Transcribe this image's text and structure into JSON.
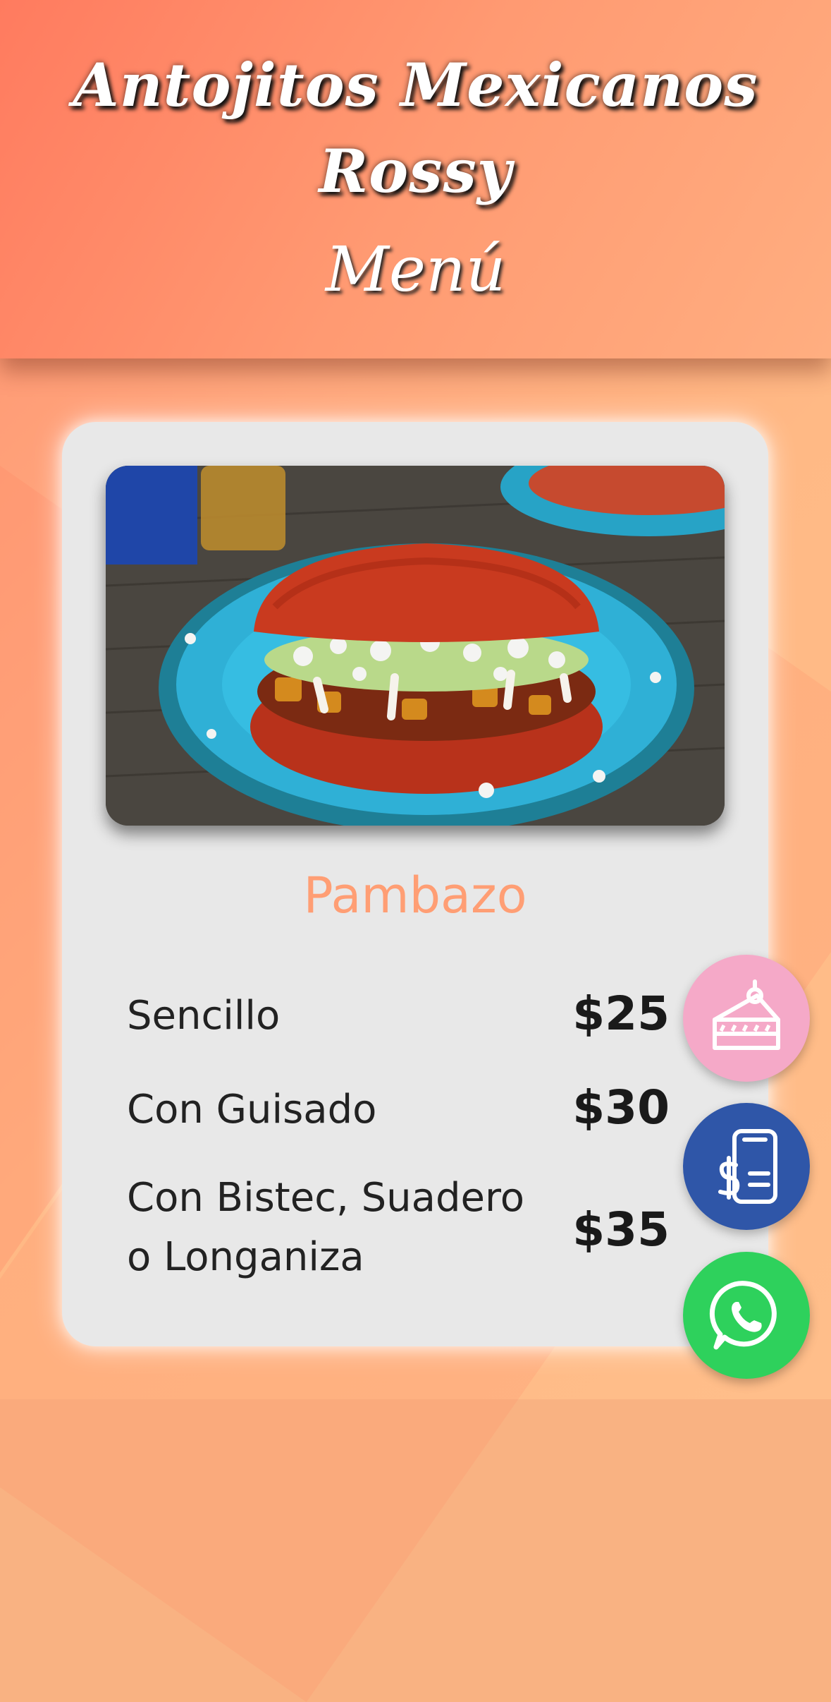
{
  "header": {
    "title_line1": "Antojitos Mexicanos",
    "title_line2": "Rossy",
    "subtitle": "Menú"
  },
  "card": {
    "photo_alt": "Pambazo",
    "item_name": "Pambazo",
    "prices": [
      {
        "label": "Sencillo",
        "price": "$25"
      },
      {
        "label": "Con Guisado",
        "price": "$30"
      },
      {
        "label_line1": "Con Bistec, Suadero",
        "label_line2": "o Longaniza",
        "price": "$35"
      }
    ]
  },
  "fabs": [
    {
      "icon": "cake-icon",
      "color": "#f5a9c8"
    },
    {
      "icon": "mobile-payment-icon",
      "color": "#2f56a8"
    },
    {
      "icon": "whatsapp-icon",
      "color": "#2ed15c"
    }
  ],
  "colors": {
    "header_from": "#ff7b5f",
    "header_to": "#ffae80",
    "card_bg": "#e8e8e8",
    "item_name": "#ff9e74"
  }
}
